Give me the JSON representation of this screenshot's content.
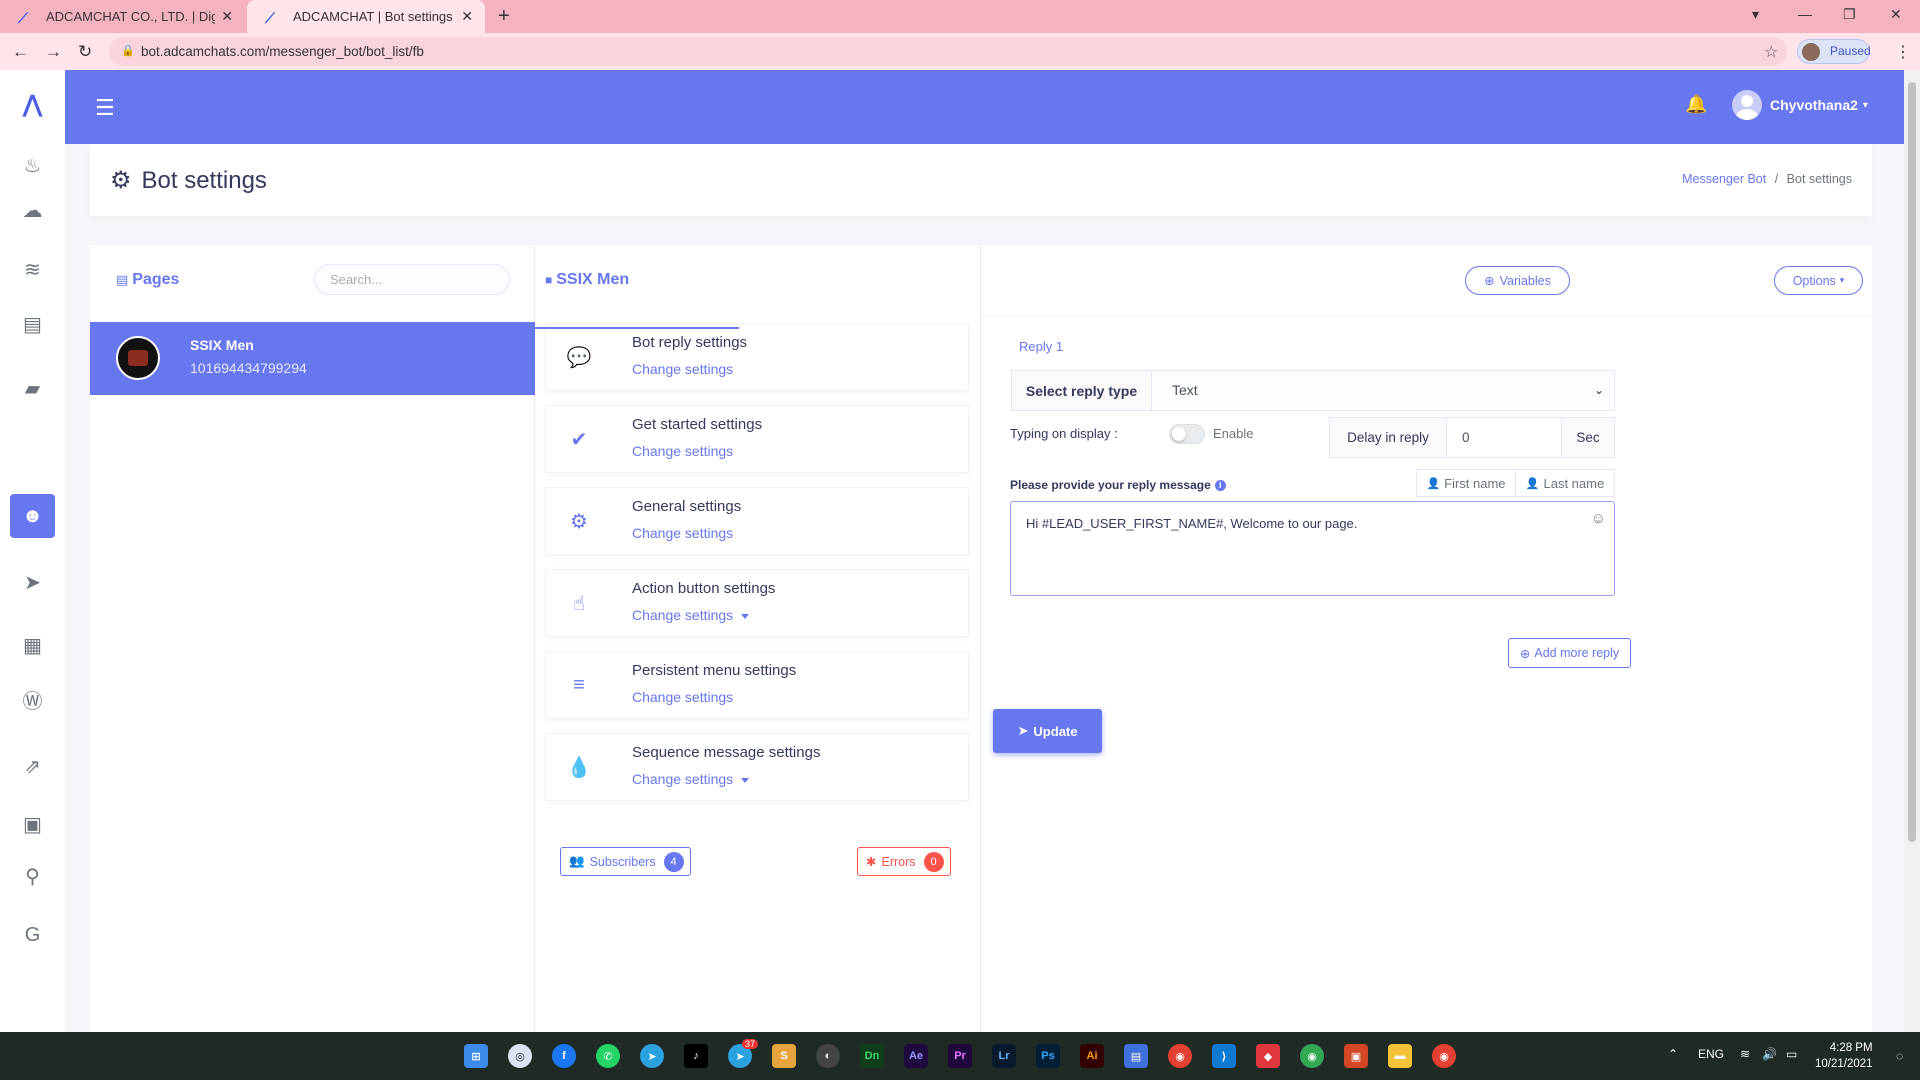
{
  "browser": {
    "tabs": [
      {
        "title": "ADCAMCHAT CO., LTD. | Digital M",
        "active": false
      },
      {
        "title": "ADCAMCHAT | Bot settings",
        "active": true
      }
    ],
    "url": "bot.adcamchats.com/messenger_bot/bot_list/fb",
    "profile_status": "Paused"
  },
  "navbar": {
    "username": "Chyvothana2"
  },
  "header": {
    "title": "Bot settings",
    "breadcrumb": [
      "Messenger Bot",
      "/",
      "Bot settings"
    ]
  },
  "pages_panel": {
    "title": "Pages",
    "search_placeholder": "Search...",
    "items": [
      {
        "name": "SSIX Men",
        "id": "101694434799294"
      }
    ]
  },
  "settings_panel": {
    "title": "SSIX Men",
    "items": [
      {
        "name": "Bot reply settings",
        "link": "Change settings",
        "icon": "comments-icon"
      },
      {
        "name": "Get started settings",
        "link": "Change settings",
        "icon": "check-circle-icon"
      },
      {
        "name": "General settings",
        "link": "Change settings",
        "icon": "gear-icon"
      },
      {
        "name": "Action button settings",
        "link": "Change settings",
        "icon": "pointer-hand-icon",
        "dropdown": true
      },
      {
        "name": "Persistent menu settings",
        "link": "Change settings",
        "icon": "bars-icon"
      },
      {
        "name": "Sequence message settings",
        "link": "Change settings",
        "icon": "drop-icon",
        "dropdown": true
      }
    ],
    "subscribers_label": "Subscribers",
    "subscribers_count": "4",
    "errors_label": "Errors",
    "errors_count": "0"
  },
  "reply_panel": {
    "variables_label": "Variables",
    "options_label": "Options",
    "reply_tab": "Reply 1",
    "reply_type_label": "Select reply type",
    "reply_type_value": "Text",
    "typing_label": "Typing on display :",
    "typing_enable_label": "Enable",
    "typing_enabled": false,
    "delay_label": "Delay in reply",
    "delay_value": "0",
    "delay_unit": "Sec",
    "message_label": "Please provide your reply message",
    "first_name_btn": "First name",
    "last_name_btn": "Last name",
    "message_value": "Hi #LEAD_USER_FIRST_NAME#, Welcome to our page.",
    "add_reply_label": "Add more reply",
    "update_label": "Update"
  },
  "taskbar": {
    "language": "ENG",
    "time": "4:28 PM",
    "date": "10/21/2021",
    "telegram_badge": "37"
  },
  "colors": {
    "accent": "#6777ef",
    "danger": "#fc544b",
    "tabbar": "#f5b3c0",
    "taskbar": "#1f2a25"
  }
}
